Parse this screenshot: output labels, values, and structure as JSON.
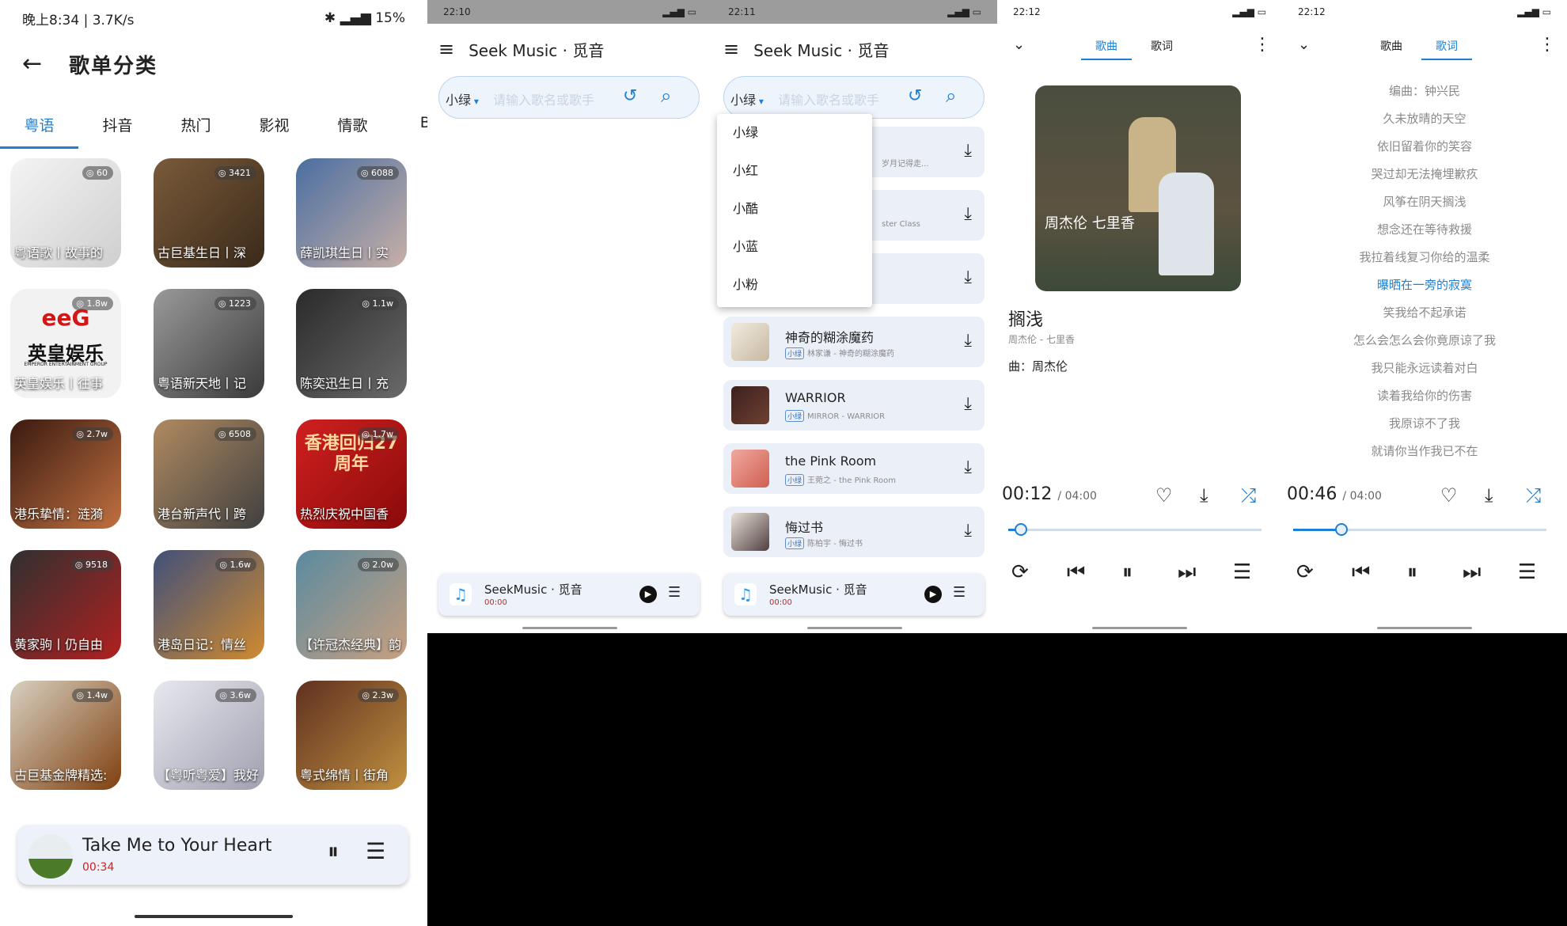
{
  "panel1": {
    "status": {
      "left": "晚上8:34 | 3.7K/s",
      "right": "15%"
    },
    "title": "歌单分类",
    "tabs": [
      "粤语",
      "抖音",
      "热门",
      "影视",
      "情歌",
      "BG"
    ],
    "tiles": [
      {
        "count": "60",
        "caption": "粤语歌丨故事的"
      },
      {
        "count": "3421",
        "caption": "古巨基生日丨深"
      },
      {
        "count": "6088",
        "caption": "薛凯琪生日丨实"
      },
      {
        "count": "1.8w",
        "caption": "英皇娱乐丨往事",
        "logo": "英皇娱乐",
        "logo_sub": "EMPEROR ENTERTAINMENT GROUP"
      },
      {
        "count": "1223",
        "caption": "粤语新天地丨记"
      },
      {
        "count": "1.1w",
        "caption": "陈奕迅生日丨充"
      },
      {
        "count": "2.7w",
        "caption": "港乐挚情：涟漪"
      },
      {
        "count": "6508",
        "caption": "港台新声代丨跨"
      },
      {
        "count": "1.7w",
        "caption": "热烈庆祝中国香",
        "logo": "香港回归27周年"
      },
      {
        "count": "9518",
        "caption": "黄家驹丨仍自由"
      },
      {
        "count": "1.6w",
        "caption": "港岛日记：情丝"
      },
      {
        "count": "2.0w",
        "caption": "【许冠杰经典】韵"
      },
      {
        "count": "1.4w",
        "caption": "古巨基金牌精选:"
      },
      {
        "count": "3.6w",
        "caption": "【粤听粤爱】我好"
      },
      {
        "count": "2.3w",
        "caption": "粤式绵情丨街角"
      }
    ],
    "now_playing": {
      "title": "Take Me to Your Heart",
      "time": "00:34"
    }
  },
  "panel2": {
    "status_time": "22:10",
    "app_title": "Seek Music · 觅音",
    "source": "小绿",
    "placeholder": "请输入歌名或歌手",
    "mini": {
      "title": "SeekMusic · 觅音",
      "time": "00:00"
    }
  },
  "panel3": {
    "status_time": "22:11",
    "app_title": "Seek Music · 觅音",
    "source": "小绿",
    "placeholder": "请输入歌名或歌手",
    "dropdown": [
      "小绿",
      "小红",
      "小酷",
      "小蓝",
      "小粉"
    ],
    "partial_rows": [
      "岁月记得走...",
      "ster Class",
      ""
    ],
    "rows": [
      {
        "title": "神奇的糊涂魔药",
        "source": "小绿",
        "sub": "林家谦 - 神奇的糊涂魔药"
      },
      {
        "title": "WARRIOR",
        "source": "小绿",
        "sub": "MIRROR - WARRIOR"
      },
      {
        "title": "the Pink Room",
        "source": "小绿",
        "sub": "王菀之 - the Pink Room"
      },
      {
        "title": "悔过书",
        "source": "小绿",
        "sub": "陈柏宇 - 悔过书"
      }
    ],
    "mini": {
      "title": "SeekMusic · 觅音",
      "time": "00:00"
    }
  },
  "panel4": {
    "status_time": "22:12",
    "tabs": [
      "歌曲",
      "歌词"
    ],
    "active_tab": 0,
    "cover_text": "周杰伦 七里香",
    "song": "搁浅",
    "artist": "周杰伦 - 七里香",
    "lyric_line": "曲：周杰伦",
    "time": "00:12",
    "duration": "04:00",
    "progress": 0.05
  },
  "panel5": {
    "status_time": "22:12",
    "tabs": [
      "歌曲",
      "歌词"
    ],
    "active_tab": 1,
    "lyrics": [
      "编曲：钟兴民",
      "久未放晴的天空",
      "依旧留着你的笑容",
      "哭过却无法掩埋歉疚",
      "风筝在阴天搁浅",
      "想念还在等待救援",
      "我拉着线复习你给的温柔",
      "曝晒在一旁的寂寞",
      "笑我给不起承诺",
      "怎么会怎么会你竟原谅了我",
      "我只能永远读着对白",
      "读着我给你的伤害",
      "我原谅不了我",
      "就请你当作我已不在"
    ],
    "current_line": 7,
    "time": "00:46",
    "duration": "04:00",
    "progress": 0.19
  },
  "colors": {
    "accent": "#1e7fd4",
    "time_red": "#d32020"
  }
}
